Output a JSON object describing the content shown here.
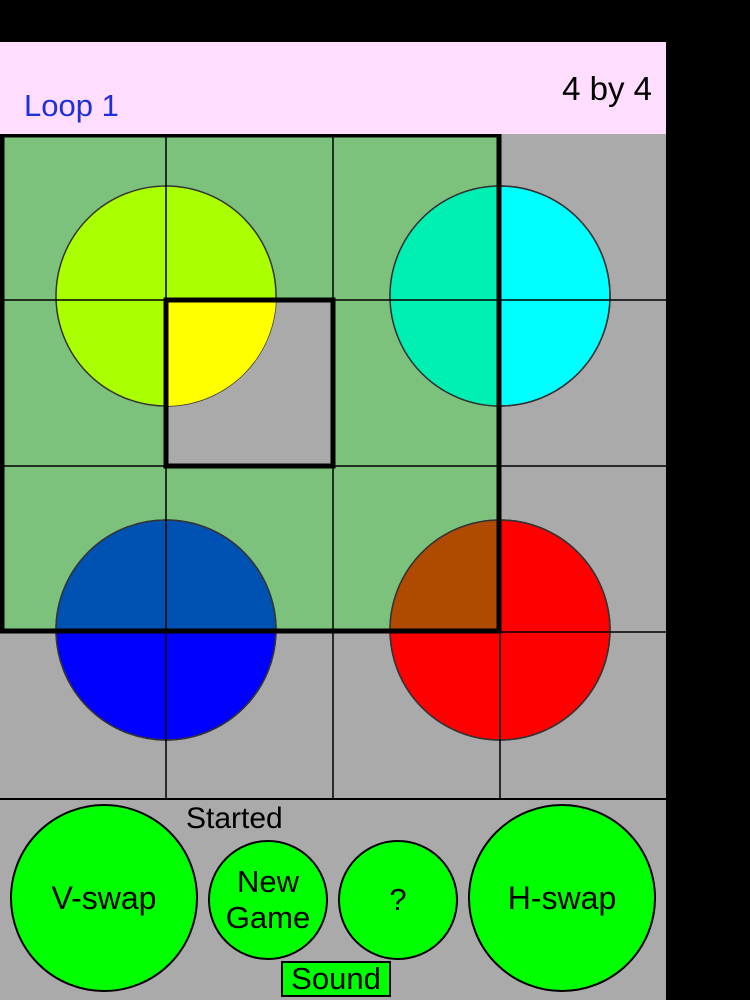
{
  "header": {
    "title": "Loop 1",
    "size_label": "4 by 4"
  },
  "board": {
    "rows": 4,
    "cols": 4,
    "cells": [
      [
        "yellow-green",
        "yellow-green",
        "cyan",
        "cyan"
      ],
      [
        "yellow-green",
        "yellow",
        "cyan",
        "cyan"
      ],
      [
        "blue",
        "blue",
        "red",
        "red"
      ],
      [
        "blue",
        "blue",
        "red",
        "red"
      ]
    ],
    "colors": {
      "background": "#aaaaaa",
      "highlight": "#7cc27c",
      "circles": {
        "yellow-green": "#aaff00",
        "yellow": "#ffff00",
        "cyan": "#00ffff",
        "red": "#ff0000",
        "blue": "#0000ff",
        "cyan-highlighted": "#00f0b4",
        "blue-highlighted": "#0052b2",
        "red-highlighted": "#b04a00"
      }
    }
  },
  "controls": {
    "status": "Started",
    "vswap_label": "V-swap",
    "new_game_label_line1": "New",
    "new_game_label_line2": "Game",
    "help_label": "?",
    "hswap_label": "H-swap",
    "sound_label": "Sound",
    "button_color": "#00ff00"
  }
}
